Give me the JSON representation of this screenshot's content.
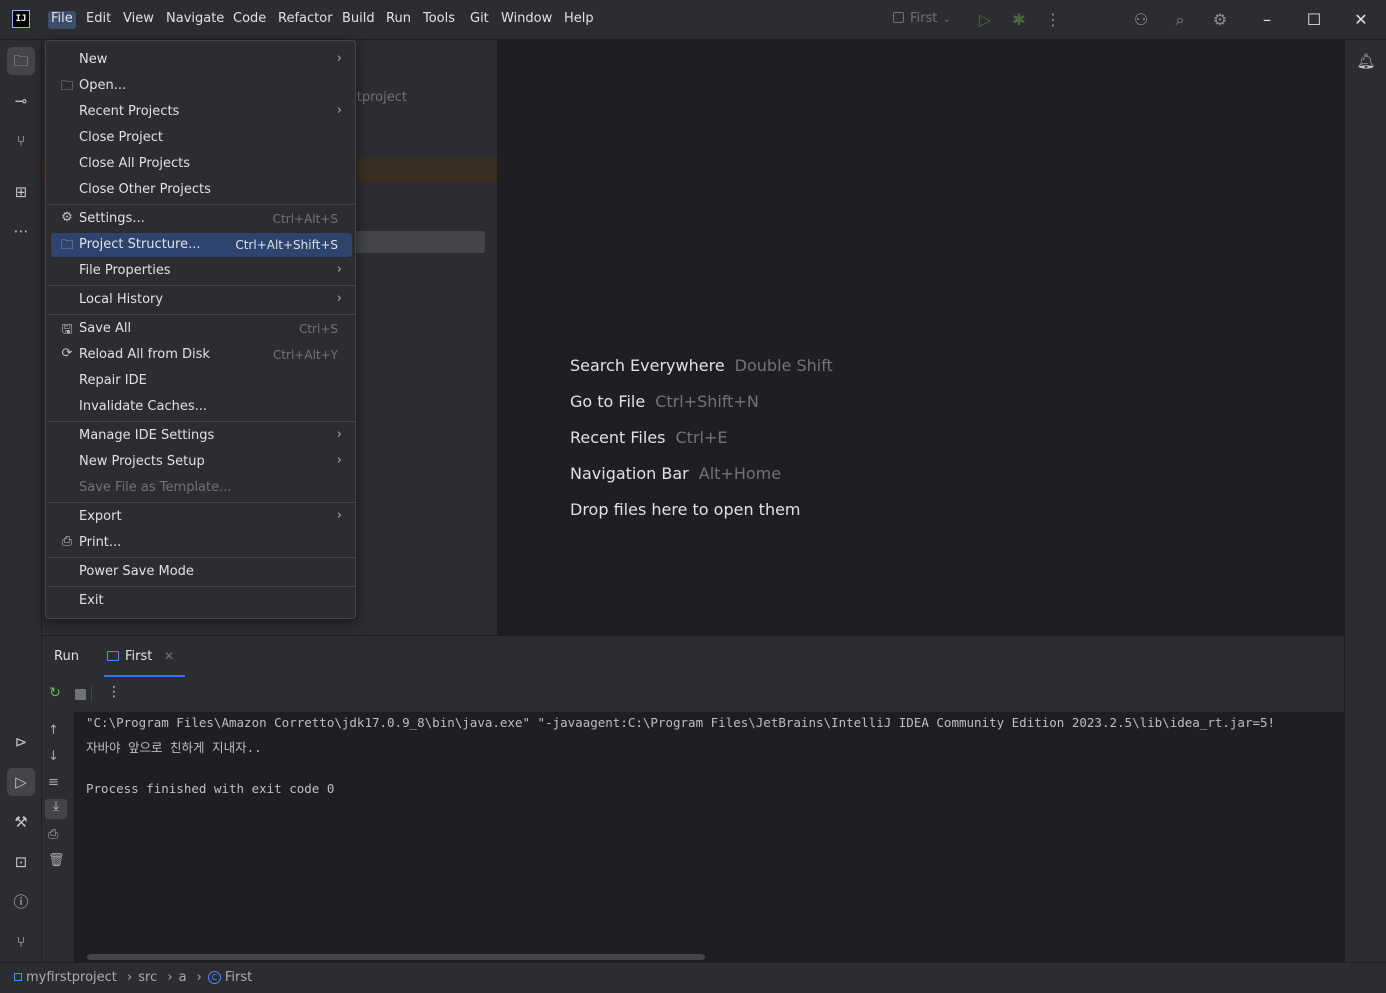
{
  "app": {
    "logo_text": "IJ",
    "accent": "#3574f0"
  },
  "menubar": {
    "items": [
      "File",
      "Edit",
      "View",
      "Navigate",
      "Code",
      "Refactor",
      "Build",
      "Run",
      "Tools",
      "Git",
      "Window",
      "Help"
    ],
    "active": "File"
  },
  "toolbar": {
    "run_config": "First",
    "run_config_icon": "checkbox-icon"
  },
  "file_menu": {
    "items": [
      {
        "label": "New",
        "submenu": true
      },
      {
        "label": "Open...",
        "icon": "folder-icon"
      },
      {
        "label": "Recent Projects",
        "submenu": true
      },
      {
        "label": "Close Project"
      },
      {
        "label": "Close All Projects"
      },
      {
        "label": "Close Other Projects"
      },
      {
        "label": "Settings...",
        "shortcut": "Ctrl+Alt+S",
        "icon": "gear-icon"
      },
      {
        "label": "Project Structure...",
        "shortcut": "Ctrl+Alt+Shift+S",
        "icon": "project-structure-icon",
        "selected": true
      },
      {
        "label": "File Properties",
        "submenu": true
      },
      {
        "label": "Local History",
        "submenu": true
      },
      {
        "label": "Save All",
        "shortcut": "Ctrl+S",
        "icon": "save-icon"
      },
      {
        "label": "Reload All from Disk",
        "shortcut": "Ctrl+Alt+Y",
        "icon": "reload-icon"
      },
      {
        "label": "Repair IDE"
      },
      {
        "label": "Invalidate Caches..."
      },
      {
        "label": "Manage IDE Settings",
        "submenu": true
      },
      {
        "label": "New Projects Setup",
        "submenu": true
      },
      {
        "label": "Save File as Template...",
        "disabled": true
      },
      {
        "label": "Export",
        "submenu": true
      },
      {
        "label": "Print...",
        "icon": "print-icon"
      },
      {
        "label": "Power Save Mode"
      },
      {
        "label": "Exit"
      }
    ]
  },
  "project_panel": {
    "partial_text": "stproject"
  },
  "editor_hints": [
    {
      "label": "Search Everywhere",
      "key": "Double Shift"
    },
    {
      "label": "Go to File",
      "key": "Ctrl+Shift+N"
    },
    {
      "label": "Recent Files",
      "key": "Ctrl+E"
    },
    {
      "label": "Navigation Bar",
      "key": "Alt+Home"
    },
    {
      "label": "Drop files here to open them",
      "key": ""
    }
  ],
  "run_panel": {
    "title": "Run",
    "tab_label": "First",
    "console_lines": [
      "\"C:\\Program Files\\Amazon Corretto\\jdk17.0.9_8\\bin\\java.exe\" \"-javaagent:C:\\Program Files\\JetBrains\\IntelliJ IDEA Community Edition 2023.2.5\\lib\\idea_rt.jar=5!",
      "자바야 앞으로 친하게 지내자..",
      "",
      "Process finished with exit code 0"
    ]
  },
  "statusbar": {
    "breadcrumb": [
      "myfirstproject",
      "src",
      "a",
      "First"
    ]
  }
}
